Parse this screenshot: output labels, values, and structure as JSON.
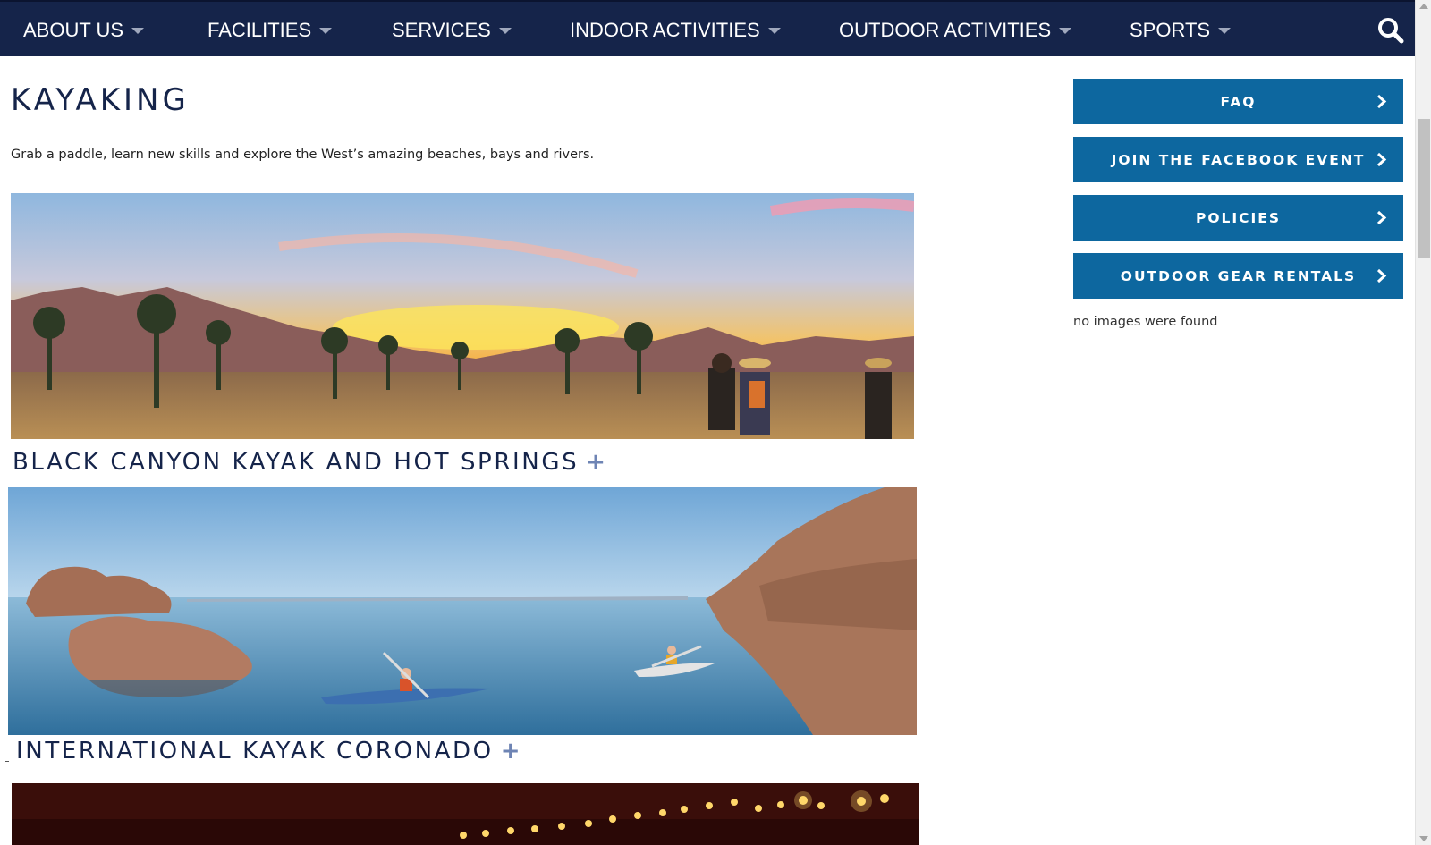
{
  "nav": {
    "items": [
      {
        "label": "ABOUT US"
      },
      {
        "label": "FACILITIES"
      },
      {
        "label": "SERVICES"
      },
      {
        "label": "INDOOR ACTIVITIES"
      },
      {
        "label": "OUTDOOR ACTIVITIES"
      },
      {
        "label": "SPORTS"
      }
    ],
    "search_icon": "search-icon"
  },
  "page": {
    "title": "KAYAKING",
    "intro": "Grab a paddle, learn new skills and explore the West’s amazing beaches, bays and rivers."
  },
  "sections": [
    {
      "heading": "BLACK CANYON KAYAK AND HOT SPRINGS",
      "expand_symbol": "+"
    },
    {
      "heading": "INTERNATIONAL KAYAK CORONADO",
      "expand_symbol": "+"
    }
  ],
  "sidebar": {
    "buttons": [
      {
        "label": "FAQ"
      },
      {
        "label": "JOIN THE FACEBOOK EVENT"
      },
      {
        "label": "POLICIES"
      },
      {
        "label": "OUTDOOR GEAR RENTALS"
      }
    ],
    "gallery_message": "no images were found"
  },
  "colors": {
    "nav_background": "#15244a",
    "sidebar_button": "#0d679f",
    "heading_text": "#15244a",
    "plus_accent": "#6e84b4"
  }
}
